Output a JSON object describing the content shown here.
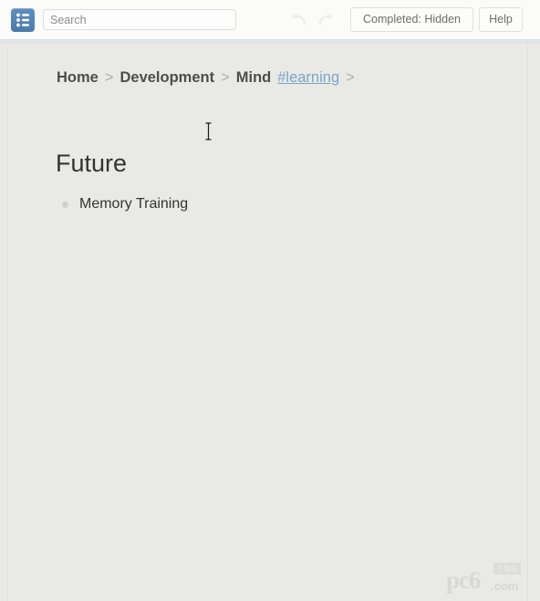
{
  "toolbar": {
    "app_icon_name": "list-app-icon",
    "search": {
      "value": "",
      "placeholder": "Search"
    },
    "undo_label": "undo-arrow-icon",
    "redo_label": "redo-arrow-icon",
    "completed_button": "Completed: Hidden",
    "help_button": "Help"
  },
  "breadcrumb": {
    "items": [
      {
        "label": "Home",
        "type": "crumb"
      },
      {
        "label": ">",
        "type": "sep"
      },
      {
        "label": "Development",
        "type": "crumb"
      },
      {
        "label": ">",
        "type": "sep"
      },
      {
        "label": "Mind",
        "type": "crumb"
      },
      {
        "label": "#learning",
        "type": "tag"
      },
      {
        "label": ">",
        "type": "sep"
      }
    ]
  },
  "page": {
    "title": "Future",
    "items": [
      {
        "label": "Memory Training"
      }
    ]
  },
  "watermark": {
    "logo": "pc6",
    "suffix": ".com",
    "badge": "下载站"
  },
  "colors": {
    "accent_blue": "#4a7aab",
    "link_blue": "#7aa6c8",
    "page_background": "#e9e9e5",
    "toolbar_background": "#fbfbfa",
    "text_dark": "#333333",
    "text_muted": "#6d6d6d",
    "bullet_gray": "#cfcfcb"
  }
}
